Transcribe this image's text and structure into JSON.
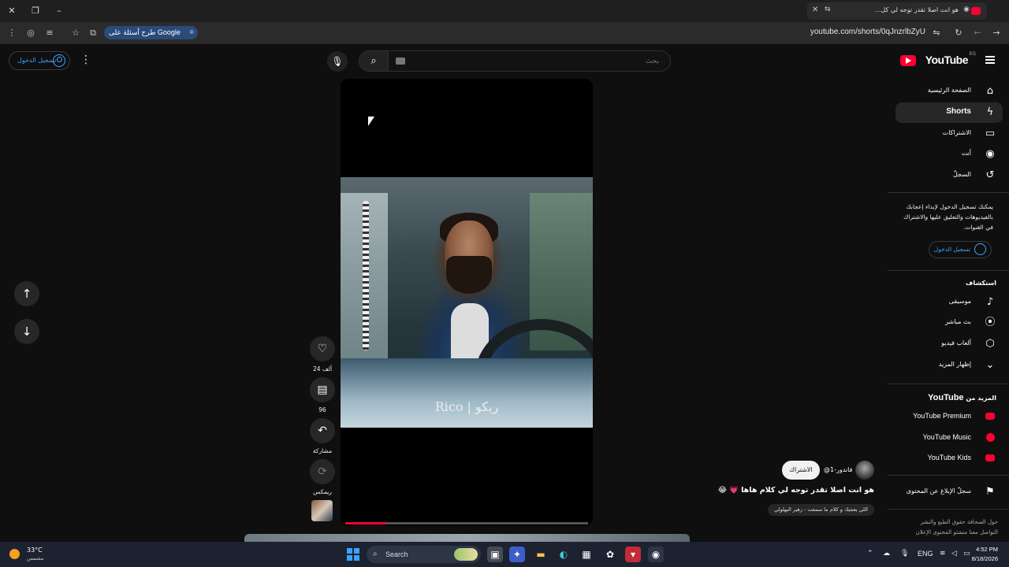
{
  "browser": {
    "tab_title": "هو انت اصلا تقدر توجه لي كل...",
    "url": "youtube.com/shorts/0qJnzrlbZyU",
    "google_chip": "طرح أسئلة على Google"
  },
  "header": {
    "signin_label": "تسجيل الدخول",
    "search_placeholder": "بحث",
    "logo_text": "YouTube",
    "logo_country": "EG"
  },
  "sidebar": {
    "items": [
      {
        "label": "الصفحة الرئيسية",
        "icon": "home-icon"
      },
      {
        "label": "Shorts",
        "icon": "shorts-icon"
      },
      {
        "label": "الاشتراكات",
        "icon": "subscriptions-icon"
      },
      {
        "label": "أنت",
        "icon": "you-icon"
      },
      {
        "label": "السجلّ",
        "icon": "history-icon"
      }
    ],
    "promo_text": "يمكنك تسجيل الدخول لإبداء إعجابك بالفيديوهات والتعليق عليها والاشتراك في القنوات.",
    "promo_signin": "تسجيل الدخول",
    "explore_title": "استكشاف",
    "explore": [
      {
        "label": "موسيقى",
        "icon": "music-icon"
      },
      {
        "label": "بث مباشر",
        "icon": "live-icon"
      },
      {
        "label": "ألعاب فيديو",
        "icon": "gaming-icon"
      },
      {
        "label": "إظهار المزيد",
        "icon": "chevron-down-icon"
      }
    ],
    "more_title_prefix": "المزيد من",
    "more_title_brand": "YouTube",
    "more": [
      {
        "label": "YouTube Premium"
      },
      {
        "label": "YouTube Music"
      },
      {
        "label": "YouTube Kids"
      }
    ],
    "report_label": "سجلّ الإبلاغ عن المحتوى",
    "footer_line1": "حول  الصحافة  حقوق الطبع والنشر",
    "footer_line2": "التواصل معنا  منشئو المحتوى  الإعلان"
  },
  "short": {
    "caption": "Rico | ريكو",
    "progress": 0.17,
    "likes": "24 ألف",
    "comments": "96",
    "share_label": "مشاركة",
    "remix_label": "ريمكس",
    "channel": "@فاندور-1",
    "subscribe_label": "الاشتراك",
    "title": "هو انت اصلا تقدر توجه لي كلام هاها",
    "title_emojis": "💗 😂",
    "sound": "اللي يعجبك و كلام ما سمعت - زهير البهلولي"
  },
  "taskbar": {
    "temp": "33°C",
    "condition": "مشمس",
    "search_label": "Search",
    "lang": "ENG",
    "time": "4:52 PM",
    "date": "8/18/2026"
  },
  "colors": {
    "accent": "#3ea6ff",
    "brand": "#ff0033"
  }
}
